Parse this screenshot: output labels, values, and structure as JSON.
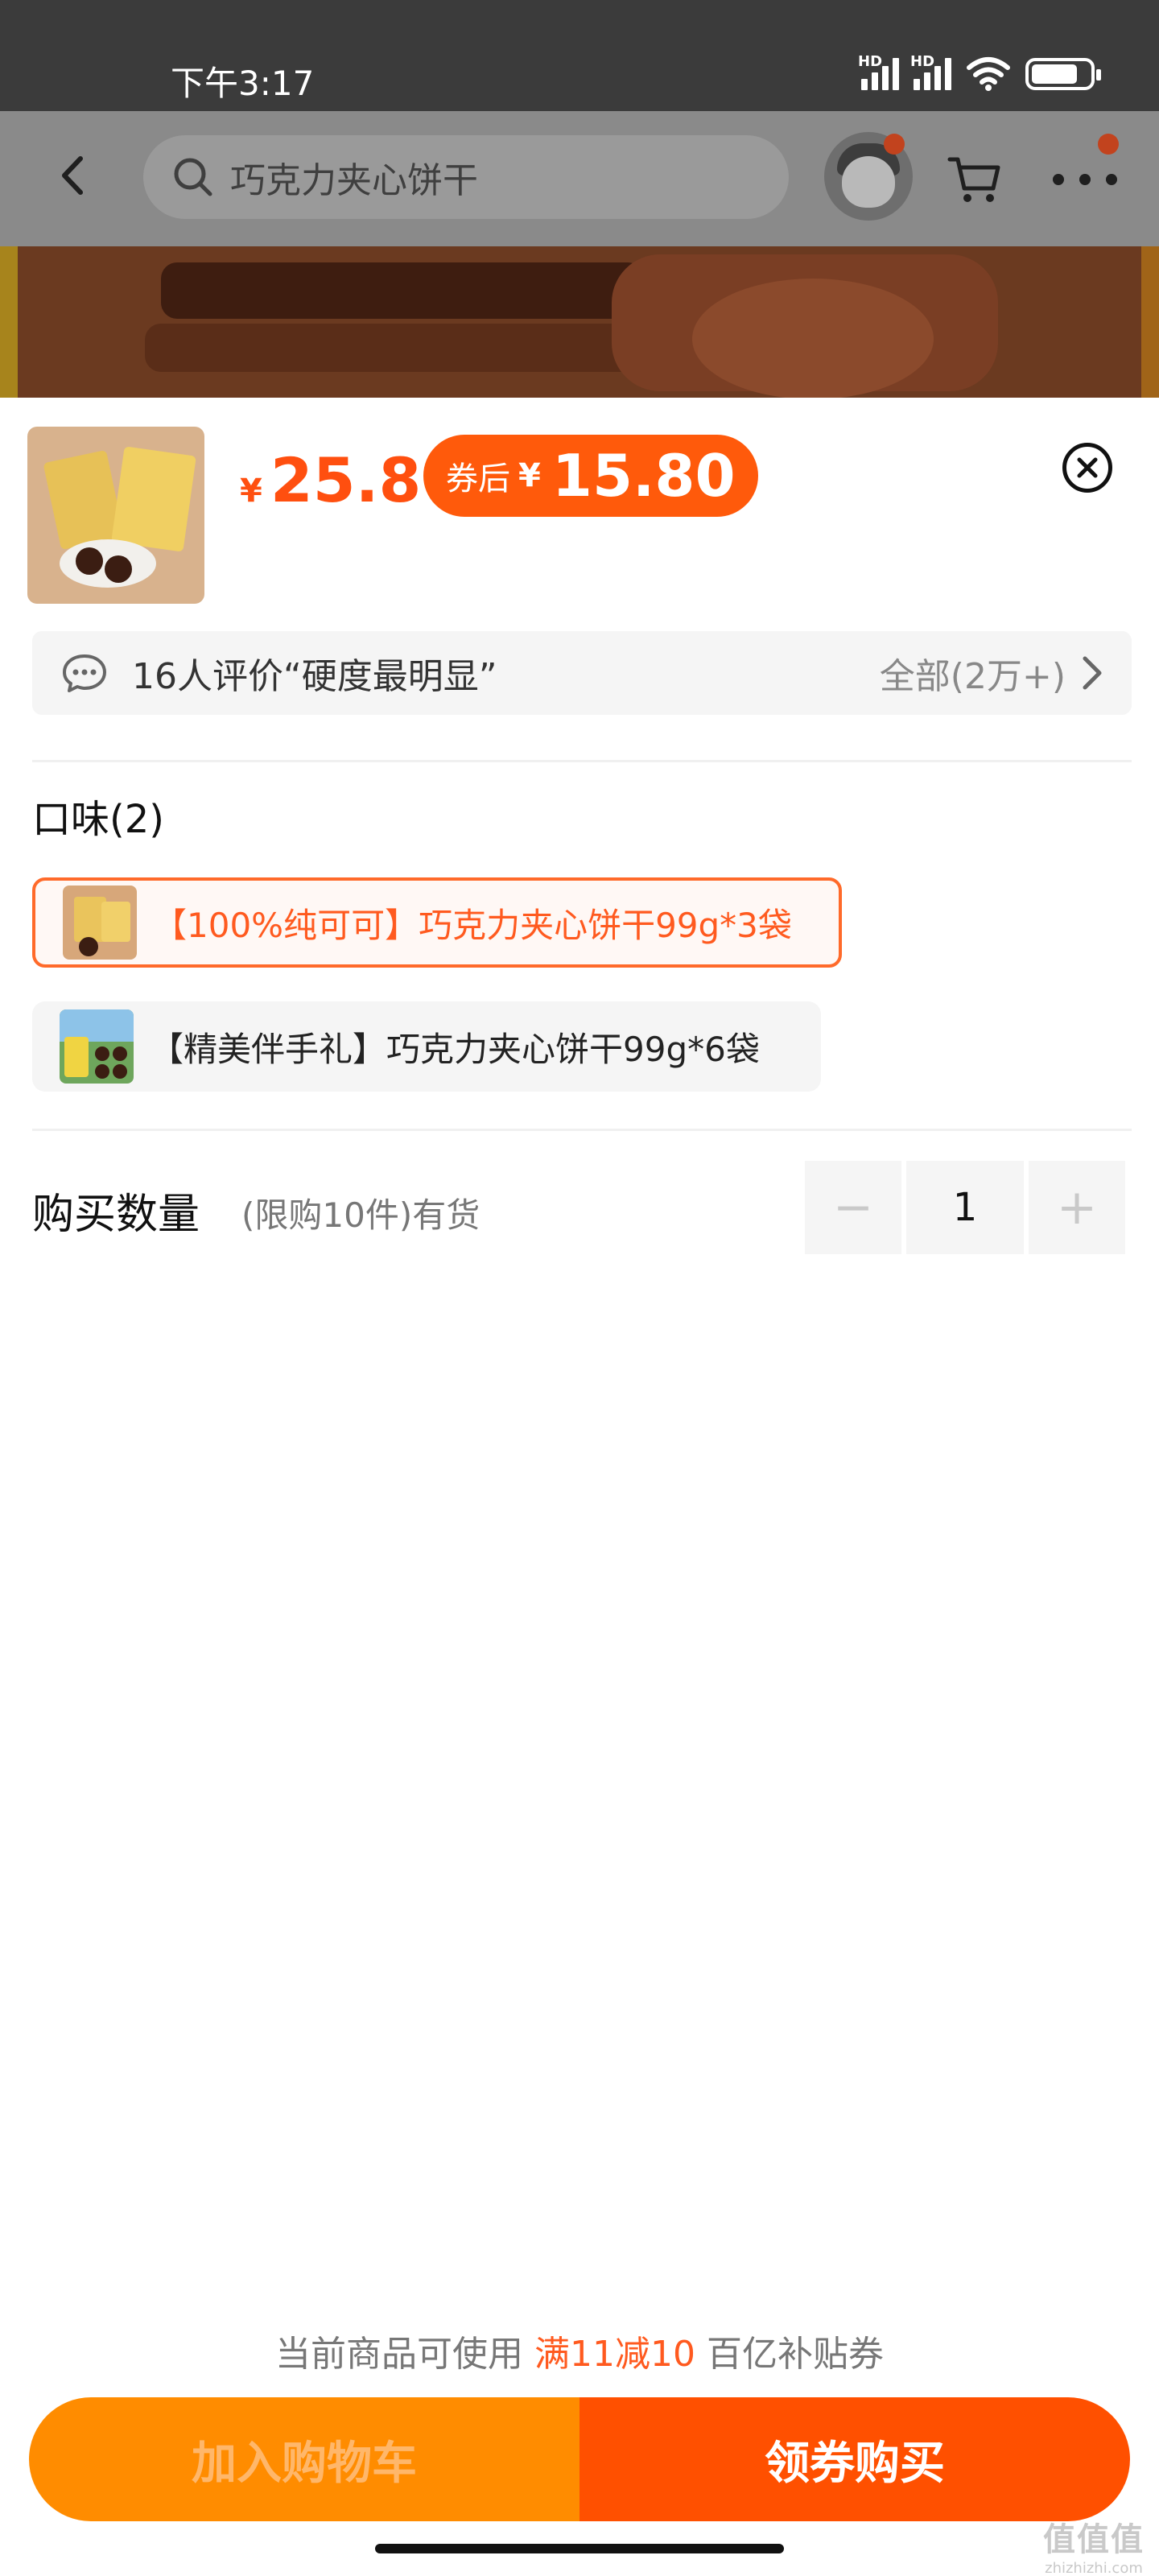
{
  "status_bar": {
    "time": "下午3:17",
    "hd1": "HD",
    "hd2": "HD",
    "icons": [
      "signal-icon",
      "signal-icon",
      "wifi-icon",
      "battery-icon"
    ]
  },
  "header": {
    "search_text": "巧克力夹心饼干",
    "icons": [
      "back-icon",
      "search-icon",
      "avatar",
      "cart-icon",
      "more-icon"
    ]
  },
  "product": {
    "price_currency": "¥",
    "price": "25.8",
    "coupon_label": "券后",
    "coupon_currency": "¥",
    "coupon_price": "15.80"
  },
  "review": {
    "text": "16人评价“硬度最明显”",
    "all_label": "全部(2万+)"
  },
  "flavor": {
    "title": "口味(2)",
    "options": [
      {
        "label": "【100%纯可可】巧克力夹心饼干99g*3袋",
        "selected": true
      },
      {
        "label": "【精美伴手礼】巧克力夹心饼干99g*6袋",
        "selected": false
      }
    ]
  },
  "quantity": {
    "title": "购买数量",
    "note": "(限购10件)有货",
    "minus": "−",
    "value": "1",
    "plus": "+"
  },
  "footer": {
    "hint_prefix": "当前商品可使用 ",
    "hint_highlight": "满11减10",
    "hint_suffix": " 百亿补贴券",
    "add_to_cart": "加入购物车",
    "buy_now": "领券购买"
  },
  "watermark": {
    "big": "值值值",
    "small": "zhizhizhi.com"
  },
  "colors": {
    "accent": "#ff5000",
    "cart_button": "#ff8c00",
    "highlight_text": "#ff5a1f"
  }
}
